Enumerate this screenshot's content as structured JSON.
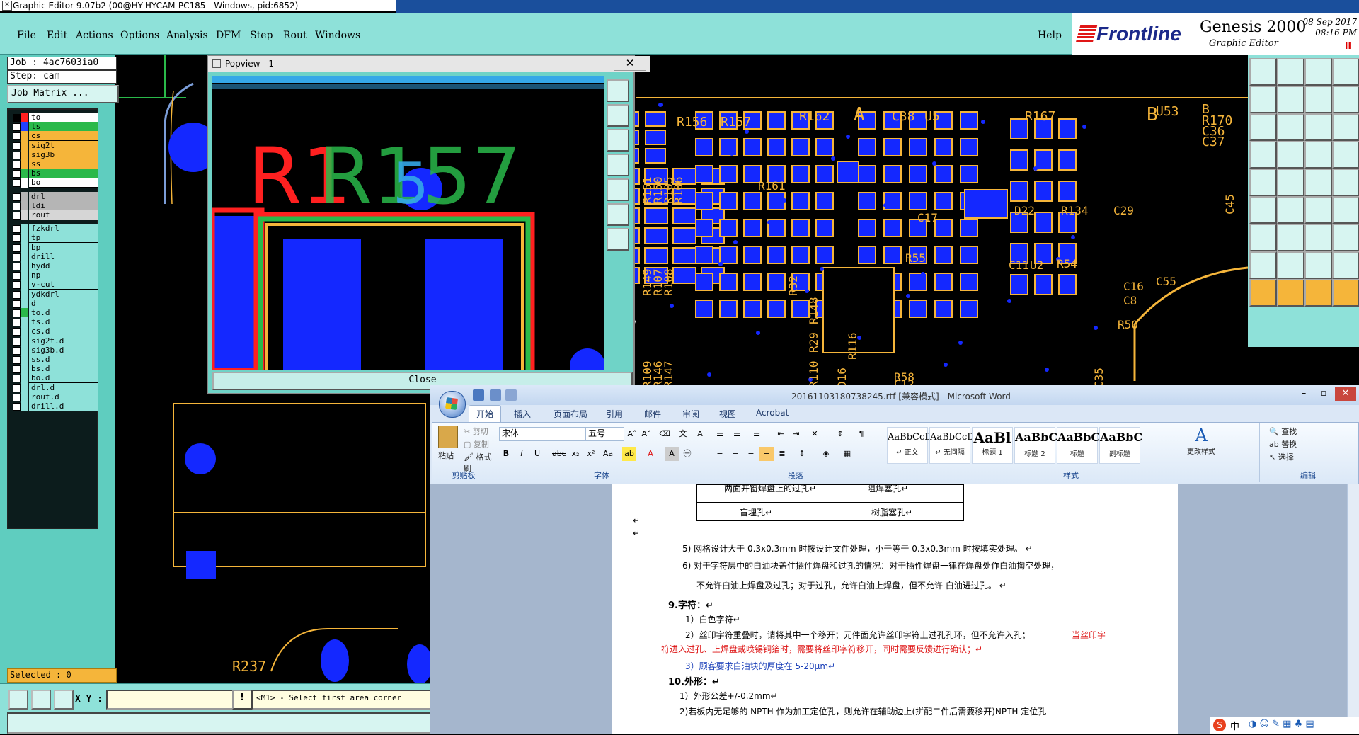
{
  "window": {
    "title": "Graphic Editor 9.07b2 (00@HY-HYCAM-PC185 - Windows, pid:6852)"
  },
  "menu": {
    "items": [
      "File",
      "Edit",
      "Actions",
      "Options",
      "Analysis",
      "DFM",
      "Step",
      "Rout",
      "Windows"
    ],
    "help": "Help"
  },
  "brand": {
    "logo": "Frontline",
    "product": "Genesis 2000",
    "subtitle": "Graphic Editor",
    "date": "08 Sep 2017",
    "time": "08:16 PM",
    "pause": "II"
  },
  "job": {
    "job_line": "Job : 4ac7603ia0",
    "step_line": "Step: cam",
    "matrix_button": "Job Matrix ..."
  },
  "layers": [
    {
      "name": "to",
      "color": "#ff2020",
      "bg": "#ffffff",
      "sel": true
    },
    {
      "name": "ts",
      "color": "#2040ff",
      "bg": "#2ab94a"
    },
    {
      "name": "cs",
      "color": "#f5b53a",
      "bg": "#f5b53a"
    },
    {
      "name": "sig2t",
      "color": "#f5b53a",
      "bg": "#f5b53a"
    },
    {
      "name": "sig3b",
      "color": "#f5b53a",
      "bg": "#f5b53a"
    },
    {
      "name": "ss",
      "color": "#f5b53a",
      "bg": "#f5b53a"
    },
    {
      "name": "bs",
      "color": "#2ab94a",
      "bg": "#2ab94a"
    },
    {
      "name": "bo",
      "color": "#ffffff",
      "bg": "#ffffff"
    },
    {
      "name": "drl",
      "color": "#b5b5b5",
      "bg": "#b5b5b5"
    },
    {
      "name": "ldi",
      "color": "#b5b5b5",
      "bg": "#b5b5b5"
    },
    {
      "name": "rout",
      "color": "#d6d6d6",
      "bg": "#d6d6d6"
    },
    {
      "name": "fzkdrl",
      "color": "#8ee1d9",
      "bg": "#8ee1d9"
    },
    {
      "name": "tp",
      "color": "#8ee1d9",
      "bg": "#8ee1d9"
    },
    {
      "name": "bp",
      "color": "#8ee1d9",
      "bg": "#8ee1d9"
    },
    {
      "name": "drill",
      "color": "#8ee1d9",
      "bg": "#8ee1d9"
    },
    {
      "name": "hydd",
      "color": "#8ee1d9",
      "bg": "#8ee1d9"
    },
    {
      "name": "np",
      "color": "#8ee1d9",
      "bg": "#8ee1d9"
    },
    {
      "name": "v-cut",
      "color": "#8ee1d9",
      "bg": "#8ee1d9"
    },
    {
      "name": "ydkdrl",
      "color": "#8ee1d9",
      "bg": "#8ee1d9"
    },
    {
      "name": "d",
      "color": "#8ee1d9",
      "bg": "#8ee1d9"
    },
    {
      "name": "to.d",
      "color": "#2ab94a",
      "bg": "#8ee1d9"
    },
    {
      "name": "ts.d",
      "color": "#8ee1d9",
      "bg": "#8ee1d9"
    },
    {
      "name": "cs.d",
      "color": "#8ee1d9",
      "bg": "#8ee1d9"
    },
    {
      "name": "sig2t.d",
      "color": "#8ee1d9",
      "bg": "#8ee1d9"
    },
    {
      "name": "sig3b.d",
      "color": "#8ee1d9",
      "bg": "#8ee1d9"
    },
    {
      "name": "ss.d",
      "color": "#8ee1d9",
      "bg": "#8ee1d9"
    },
    {
      "name": "bs.d",
      "color": "#8ee1d9",
      "bg": "#8ee1d9"
    },
    {
      "name": "bo.d",
      "color": "#8ee1d9",
      "bg": "#8ee1d9"
    },
    {
      "name": "drl.d",
      "color": "#8ee1d9",
      "bg": "#8ee1d9"
    },
    {
      "name": "rout.d",
      "color": "#8ee1d9",
      "bg": "#8ee1d9"
    },
    {
      "name": "drill.d",
      "color": "#8ee1d9",
      "bg": "#8ee1d9"
    }
  ],
  "status": {
    "selected": "Selected : 0",
    "xy_label": "X Y :",
    "xy_value": "",
    "info": "!",
    "prompt": "<M1> - Select first area corner"
  },
  "popview": {
    "title": "Popview - 1",
    "close": "Close",
    "label_red": "R1",
    "label_green": "R157",
    "label_mid": "5"
  },
  "pcb_labels": {
    "top": [
      "R156",
      "R157",
      "R162",
      "A",
      "C38",
      "U5",
      "R167",
      "B",
      "U53",
      "B",
      "R170",
      "C36",
      "C37",
      "R160"
    ],
    "mid": [
      "R151",
      "R150",
      "R105",
      "R106",
      "R161",
      "D22",
      "R134",
      "C29",
      "C45",
      "C17",
      "R55",
      "R54",
      "C11",
      "U2",
      "C16",
      "C55",
      "C8",
      "R50"
    ],
    "vert": [
      "R149",
      "R107",
      "R108",
      "R32",
      "R148",
      "R29",
      "R110",
      "D16",
      "R116",
      "R58",
      "C12",
      "R109",
      "R146",
      "R147",
      "C35"
    ],
    "left_bottom": "R237"
  },
  "word": {
    "title": "20161103180738245.rtf [兼容模式] - Microsoft Word",
    "tabs": [
      "开始",
      "插入",
      "页面布局",
      "引用",
      "邮件",
      "审阅",
      "视图",
      "Acrobat"
    ],
    "clipboard": {
      "paste": "粘贴",
      "cut": "剪切",
      "copy": "复制",
      "format_painter": "格式刷",
      "label": "剪贴板"
    },
    "font": {
      "name": "宋体",
      "size": "五号",
      "label": "字体"
    },
    "paragraph_label": "段落",
    "styles": [
      {
        "preview": "AaBbCcDc",
        "name": "↵ 正文"
      },
      {
        "preview": "AaBbCcDc",
        "name": "↵ 无间隔"
      },
      {
        "preview": "AaBl",
        "name": "标题 1"
      },
      {
        "preview": "AaBbC",
        "name": "标题 2"
      },
      {
        "preview": "AaBbC",
        "name": "标题"
      },
      {
        "preview": "AaBbC",
        "name": "副标题"
      }
    ],
    "change_styles": "更改样式",
    "styles_label": "样式",
    "editing": {
      "find": "查找",
      "replace": "替换",
      "select": "选择",
      "label": "编辑"
    },
    "doc": {
      "table_rows": [
        [
          "两面开窗焊盘上的过孔↵",
          "阻焊塞孔↵"
        ],
        [
          "盲埋孔↵",
          "树脂塞孔↵"
        ]
      ],
      "lines": [
        {
          "t": "↵",
          "cls": ""
        },
        {
          "t": "↵",
          "cls": ""
        },
        {
          "t": "5)   网格设计大于 0.3x0.3mm 时按设计文件处理，小于等于 0.3x0.3mm 时按填实处理。 ↵",
          "cls": ""
        },
        {
          "t": "6)   对于字符层中的白油块盖住插件焊盘和过孔的情况：对于插件焊盘一律在焊盘处作白油掏空处理，",
          "cls": ""
        },
        {
          "t": "不允许白油上焊盘及过孔；对于过孔，允许白油上焊盘，但不允许 白油进过孔。 ↵",
          "cls": ""
        },
        {
          "t": "9.字符：↵",
          "cls": "b"
        },
        {
          "t": "1）白色字符↵",
          "cls": ""
        },
        {
          "t": "2）丝印字符重叠时，请将其中一个移开；元件面允许丝印字符上过孔孔环，但不允许入孔；",
          "cls": ""
        },
        {
          "t": "当丝印字",
          "cls": "red"
        },
        {
          "t": "符进入过孔、上焊盘或喷锡铜箔时，需要将丝印字符移开，同时需要反馈进行确认；↵",
          "cls": "red"
        },
        {
          "t": "3）顾客要求白油块的厚度在 5-20μm↵",
          "cls": "blue"
        },
        {
          "t": "10.外形：↵",
          "cls": "b"
        },
        {
          "t": "1）外形公差+/-0.2mm↵",
          "cls": ""
        },
        {
          "t": "2)若板内无足够的 NPTH 作为加工定位孔，则允许在辅助边上(拼配二件后需要移开)NPTH 定位孔",
          "cls": ""
        }
      ]
    }
  },
  "ime": {
    "text": "中"
  }
}
